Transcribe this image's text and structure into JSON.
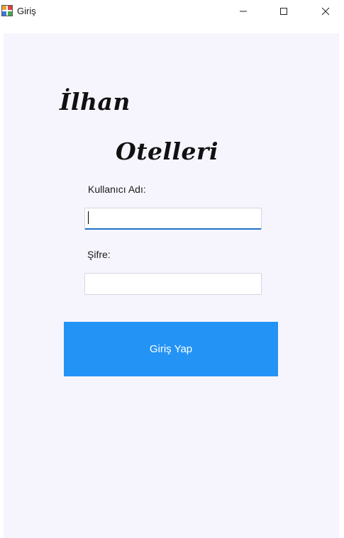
{
  "window": {
    "title": "Giriş",
    "icon": "form-icon",
    "controls": {
      "minimize": "minimize-icon",
      "maximize": "maximize-icon",
      "close": "close-icon"
    }
  },
  "brand": {
    "line1": "İlhan",
    "line2": "Otelleri"
  },
  "form": {
    "username_label": "Kullanıcı Adı:",
    "username_value": "",
    "password_label": "Şifre:",
    "password_value": "",
    "submit_label": "Giriş Yap"
  },
  "colors": {
    "accent": "#2393f6",
    "focus_border": "#1f6fc4",
    "client_bg": "#f6f5fd"
  }
}
